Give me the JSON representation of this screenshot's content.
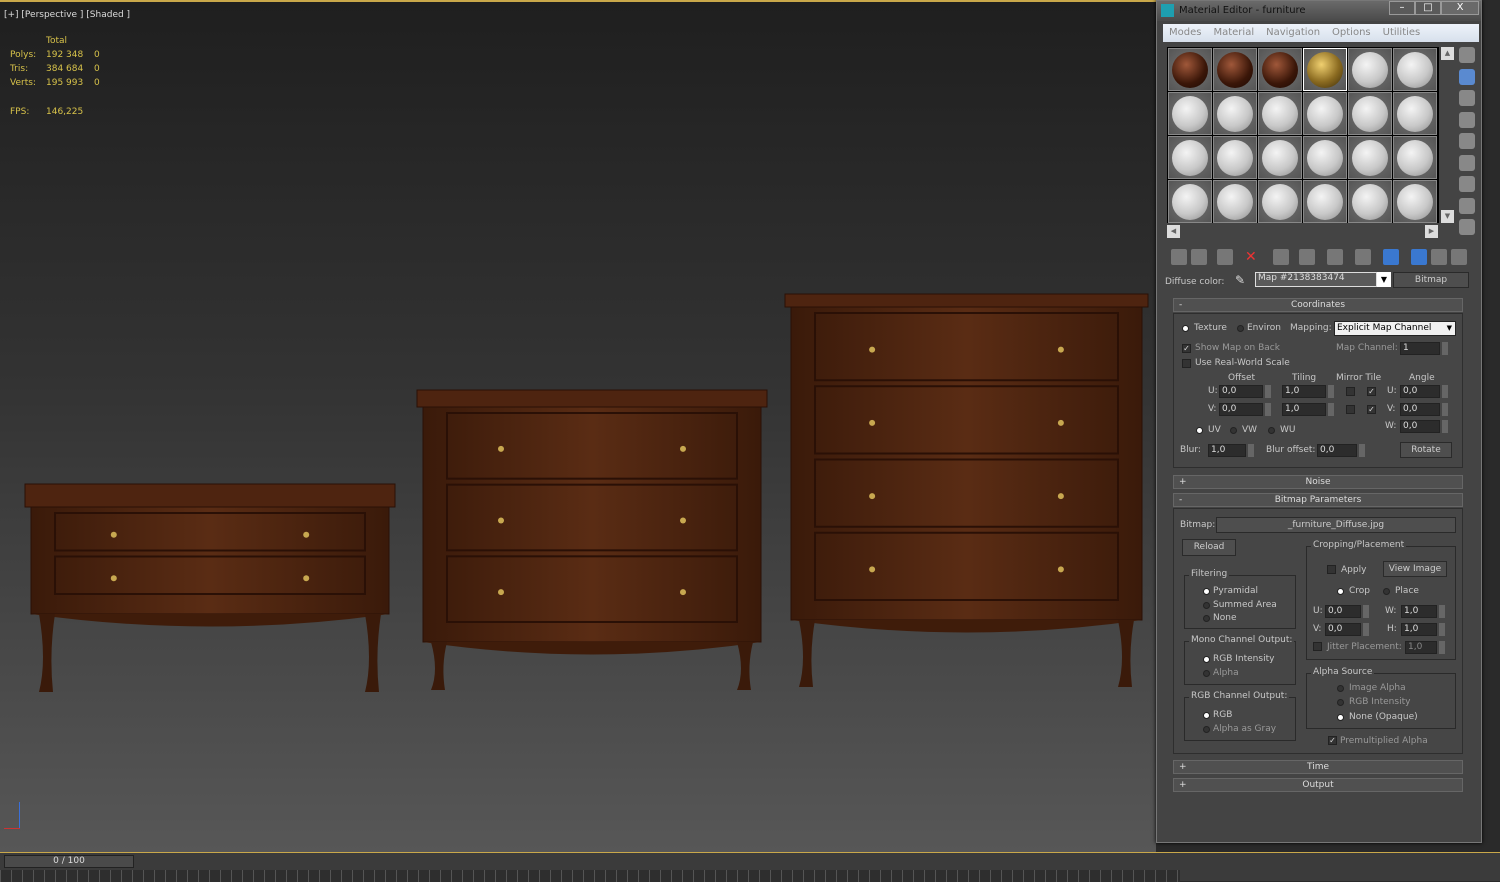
{
  "viewport": {
    "label": "[+] [Perspective ] [Shaded ]",
    "stats": {
      "header": "Total",
      "rows": [
        {
          "k": "Polys:",
          "v": "192 348",
          "s": "0"
        },
        {
          "k": "Tris:",
          "v": "384 684",
          "s": "0"
        },
        {
          "k": "Verts:",
          "v": "195 993",
          "s": "0"
        }
      ],
      "fps_label": "FPS:",
      "fps": "146,225"
    },
    "wood_color": "#4a2210"
  },
  "timeline": {
    "frame": "0 / 100",
    "prev": "<",
    "next": ">"
  },
  "editor": {
    "title": "Material Editor - furniture",
    "window_buttons": [
      "–",
      "□",
      "X"
    ],
    "menu": [
      "Modes",
      "Material",
      "Navigation",
      "Options",
      "Utilities"
    ],
    "slots": [
      "wood",
      "wood",
      "wood",
      "gold",
      "default",
      "default",
      "default",
      "default",
      "default",
      "default",
      "default",
      "default",
      "default",
      "default",
      "default",
      "default",
      "default",
      "default",
      "default",
      "default",
      "default",
      "default",
      "default",
      "default"
    ],
    "active_slot": 3,
    "diffuse_label": "Diffuse color:",
    "map_name": "Map #2138383474",
    "map_type": "Bitmap",
    "coordinates": {
      "title": "Coordinates",
      "collapse": "-",
      "texture": "Texture",
      "environ": "Environ",
      "mapping_label": "Mapping:",
      "mapping": "Explicit Map Channel",
      "show_map_on_back": "Show Map on Back",
      "real_world": "Use Real-World Scale",
      "map_channel_label": "Map Channel:",
      "map_channel": "1",
      "offset": "Offset",
      "tiling": "Tiling",
      "mirror_tile": "Mirror Tile",
      "angle": "Angle",
      "u": "U:",
      "v": "V:",
      "w": "W:",
      "offset_u": "0,0",
      "offset_v": "0,0",
      "tiling_u": "1,0",
      "tiling_v": "1,0",
      "angle_u": "0,0",
      "angle_v": "0,0",
      "angle_w": "0,0",
      "uv": "UV",
      "vw": "VW",
      "wu": "WU",
      "blur_label": "Blur:",
      "blur": "1,0",
      "blur_offset_label": "Blur offset:",
      "blur_offset": "0,0",
      "rotate": "Rotate"
    },
    "noise": {
      "title": "Noise",
      "expand": "+"
    },
    "bitmap_params": {
      "title": "Bitmap Parameters",
      "collapse": "-",
      "bitmap_label": "Bitmap:",
      "bitmap": "_furniture_Diffuse.jpg",
      "reload": "Reload",
      "filtering": "Filtering",
      "pyramidal": "Pyramidal",
      "summed": "Summed Area",
      "none": "None",
      "mono": "Mono Channel Output:",
      "rgb_intensity": "RGB Intensity",
      "alpha": "Alpha",
      "rgb_out": "RGB Channel Output:",
      "rgb": "RGB",
      "alpha_gray": "Alpha as Gray",
      "cropping": "Cropping/Placement",
      "apply": "Apply",
      "view_image": "View Image",
      "crop": "Crop",
      "place": "Place",
      "u": "U:",
      "v": "V:",
      "w": "W:",
      "h": "H:",
      "cu": "0,0",
      "cv": "0,0",
      "cw": "1,0",
      "ch": "1,0",
      "jitter": "Jitter Placement:",
      "jitter_val": "1,0",
      "alpha_source": "Alpha Source",
      "image_alpha": "Image Alpha",
      "rgb_int": "RGB Intensity",
      "none_opaque": "None (Opaque)",
      "premult": "Premultiplied Alpha"
    },
    "time": {
      "title": "Time",
      "expand": "+"
    },
    "output": {
      "title": "Output",
      "expand": "+"
    }
  }
}
